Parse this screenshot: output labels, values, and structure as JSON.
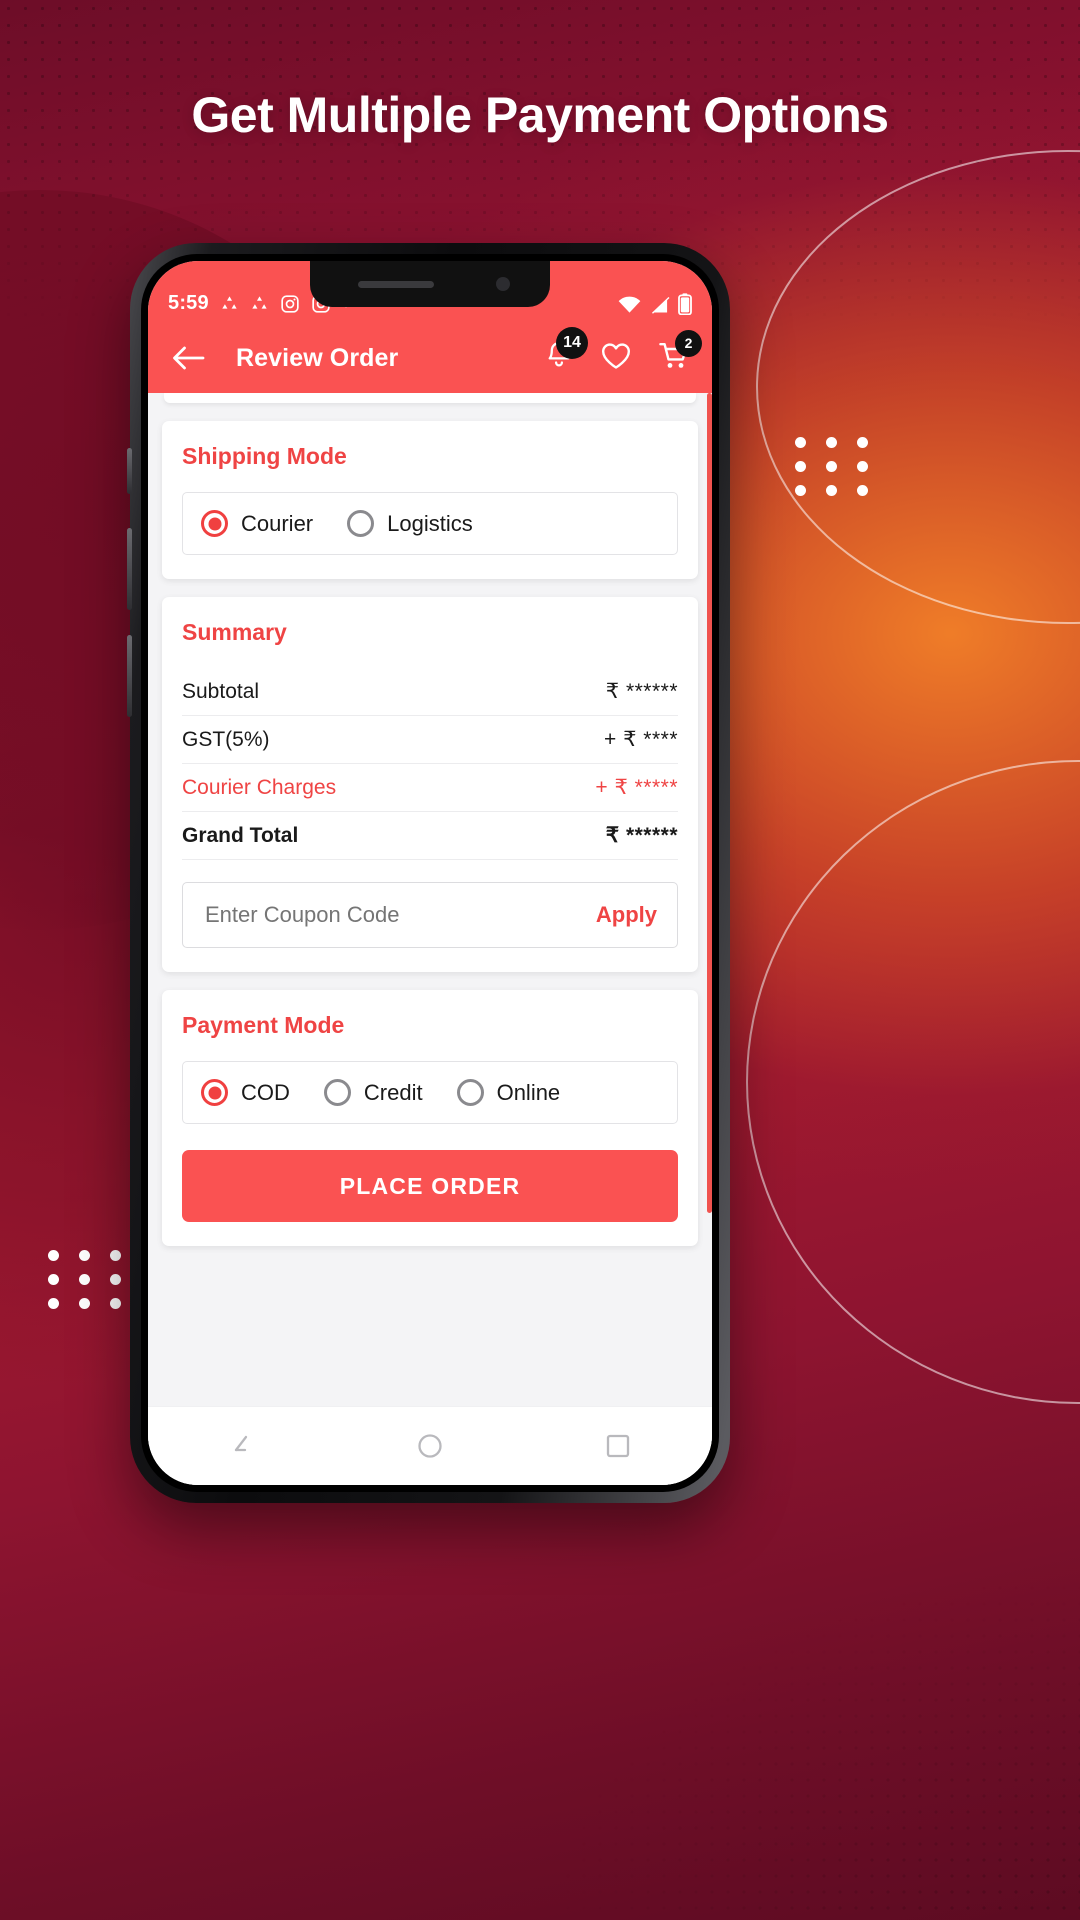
{
  "banner": {
    "headline": "Get Multiple Payment Options"
  },
  "colors": {
    "accent": "#fa5252",
    "accent_text": "#ef4444",
    "badge_bg": "#111111",
    "page_bg": "#f4f4f6",
    "card_bg": "#ffffff",
    "gradient_start": "#6d0d28",
    "gradient_mid": "#a8192f",
    "gradient_orange": "#f38228"
  },
  "phone": {
    "statusbar": {
      "time": "5:59",
      "left_icons": [
        "share-icon",
        "share-icon",
        "instagram-icon",
        "instagram-icon",
        "dot-icon"
      ],
      "right_icons": [
        "wifi-icon",
        "signal-off-icon",
        "battery-icon"
      ]
    },
    "appbar": {
      "back_icon": "arrow-left-icon",
      "title": "Review Order",
      "actions": [
        {
          "icon": "bell-icon",
          "badge": "14"
        },
        {
          "icon": "heart-icon",
          "badge": ""
        },
        {
          "icon": "cart-icon",
          "badge": "2"
        }
      ]
    },
    "shipping": {
      "title": "Shipping Mode",
      "options": [
        {
          "label": "Courier",
          "selected": true
        },
        {
          "label": "Logistics",
          "selected": false
        }
      ]
    },
    "summary": {
      "title": "Summary",
      "rows": [
        {
          "label": "Subtotal",
          "value": "₹ ******",
          "accent": false,
          "bold": false
        },
        {
          "label": "GST(5%)",
          "value": "+ ₹ ****",
          "accent": false,
          "bold": false
        },
        {
          "label": "Courier Charges",
          "value": "+ ₹ *****",
          "accent": true,
          "bold": false
        },
        {
          "label": "Grand Total",
          "value": "₹ ******",
          "accent": false,
          "bold": true
        }
      ],
      "coupon": {
        "placeholder": "Enter Coupon Code",
        "value": "",
        "apply_label": "Apply"
      }
    },
    "payment": {
      "title": "Payment Mode",
      "options": [
        {
          "label": "COD",
          "selected": true
        },
        {
          "label": "Credit",
          "selected": false
        },
        {
          "label": "Online",
          "selected": false
        }
      ]
    },
    "place_order_label": "PLACE ORDER",
    "navbar": [
      "back-nav-icon",
      "home-nav-icon",
      "recents-nav-icon"
    ]
  }
}
